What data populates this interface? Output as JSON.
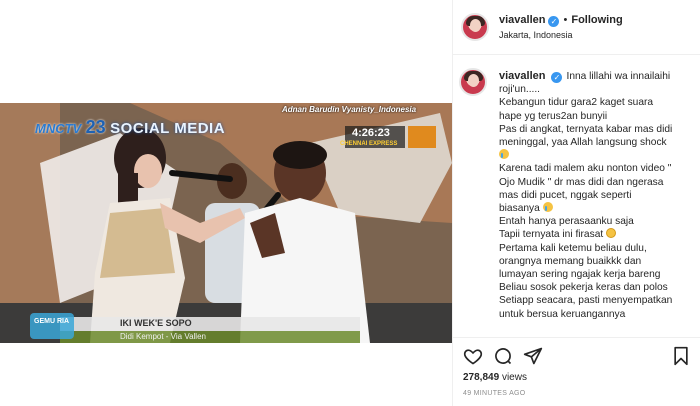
{
  "post": {
    "username": "viavallen",
    "following_label": "Following",
    "location": "Jakarta, Indonesia",
    "caption_lines": [
      "Inna lillahi wa innailaihi",
      "roji'un.....",
      "Kebangun tidur gara2 kaget suara",
      "hape yg terus2an bunyii",
      "Pas di angkat, ternyata kabar mas didi",
      "meninggal, yaa Allah langsung shock",
      "",
      "Karena tadi malem aku nonton video \"",
      "Ojo Mudik \" dr mas didi dan ngerasa",
      "mas didi pucet, nggak seperti",
      "biasanya",
      "Entah hanya perasaanku saja",
      "Tapii ternyata ini firasat",
      "Pertama kali ketemu beliau dulu,",
      "orangnya memang buaikkk dan",
      "lumayan sering ngajak kerja bareng",
      "Beliau sosok pekerja keras dan polos",
      "Setiapp seacara, pasti menyempatkan",
      "untuk bersua keruangannya"
    ],
    "views_count": "278,849",
    "views_label": "views",
    "time_ago": "49 MINUTES AGO"
  },
  "video": {
    "overlay_credit": "Adnan Barudin Vyanisty_Indonesia",
    "channel_logo": "MNCTV",
    "channel_number": "23",
    "program": "SOCIAL MEDIA",
    "clock": "4:26:23",
    "sponsor": "CHENNAI EXPRESS",
    "song_title": "IKI WEK'E SOPO",
    "song_artist": "Didi Kempot - Via Vallen",
    "corner_logo": "GEMU RIA"
  }
}
